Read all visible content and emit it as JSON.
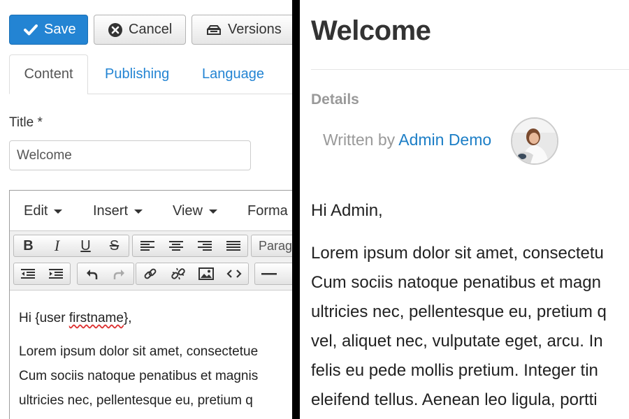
{
  "toolbar": {
    "save_label": "Save",
    "cancel_label": "Cancel",
    "versions_label": "Versions"
  },
  "tabs": [
    {
      "label": "Content",
      "active": true
    },
    {
      "label": "Publishing",
      "active": false
    },
    {
      "label": "Language",
      "active": false
    }
  ],
  "form": {
    "title_label": "Title *",
    "title_value": "Welcome"
  },
  "editor": {
    "menus": [
      "Edit",
      "Insert",
      "View",
      "Forma"
    ],
    "format_select": "Parag",
    "greeting_prefix": "Hi {user ",
    "greeting_misspelled": "firstname",
    "greeting_suffix": "},",
    "body_lines": [
      "Lorem ipsum dolor sit amet, consectetue",
      "Cum sociis natoque penatibus et magnis",
      "ultricies nec, pellentesque eu, pretium q"
    ]
  },
  "preview": {
    "title": "Welcome",
    "details_heading": "Details",
    "written_by_prefix": "Written by ",
    "author": "Admin Demo",
    "greeting": "Hi Admin,",
    "body_lines": [
      "Lorem ipsum dolor sit amet, consectetu",
      "Cum sociis natoque penatibus et magn",
      "ultricies nec, pellentesque eu, pretium q",
      "vel, aliquet nec, vulputate eget, arcu. In",
      "felis eu pede mollis pretium. Integer tin",
      "eleifend tellus. Aenean leo ligula, portti"
    ]
  },
  "colors": {
    "primary": "#2384d3",
    "link": "#1c7ec6",
    "divider": "#000000"
  },
  "icons": [
    "check-icon",
    "cancel-circle-icon",
    "versions-icon",
    "bold-icon",
    "italic-icon",
    "underline-icon",
    "strikethrough-icon",
    "align-left-icon",
    "align-center-icon",
    "align-right-icon",
    "align-justify-icon",
    "outdent-icon",
    "indent-icon",
    "undo-icon",
    "redo-icon",
    "link-icon",
    "unlink-icon",
    "image-icon",
    "code-icon",
    "horizontal-rule-icon",
    "avatar"
  ]
}
